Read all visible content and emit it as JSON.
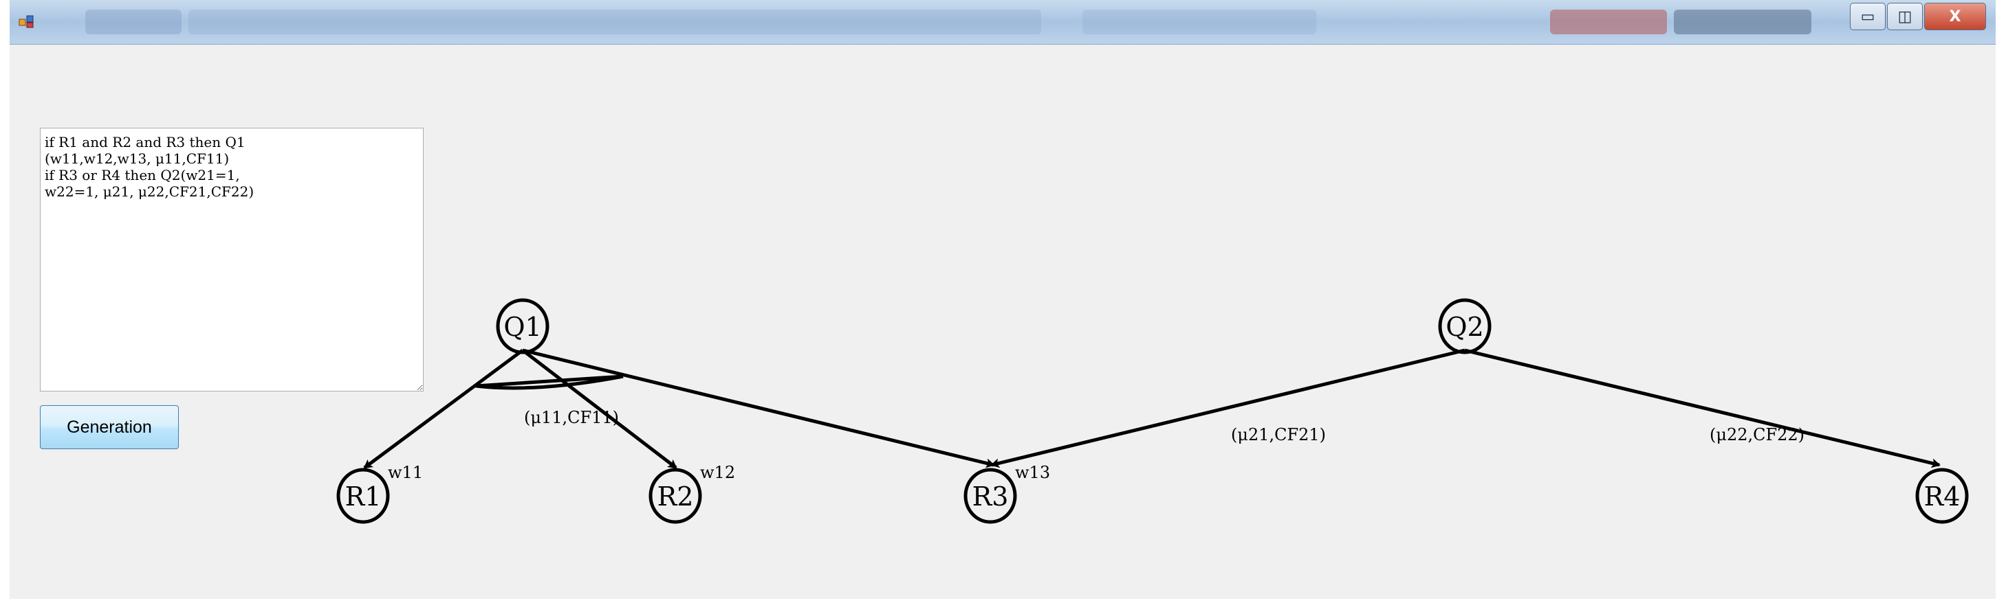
{
  "rules_text": "if R1 and R2 and R3 then Q1\n(w11,w12,w13, μ11,CF11)\nif R3 or R4 then Q2(w21=1,\nw22=1, μ21, μ22,CF21,CF22)",
  "generation_button": "Generation",
  "window_buttons": {
    "minimize": "▭",
    "maximize": "◫",
    "close": "X"
  },
  "nodes": {
    "q1": "Q1",
    "q2": "Q2",
    "r1": "R1",
    "r2": "R2",
    "r3": "R3",
    "r4": "R4"
  },
  "weights": {
    "w11": "w11",
    "w12": "w12",
    "w13": "w13"
  },
  "edge_labels": {
    "q1_rule": "(μ11,CF11)",
    "q2_r3": "(μ21,CF21)",
    "q2_r4": "(μ22,CF22)"
  },
  "colors": {
    "titlebar": "#a9c4e2",
    "window_bg": "#f0f0f0",
    "close_button": "#c4442d"
  }
}
